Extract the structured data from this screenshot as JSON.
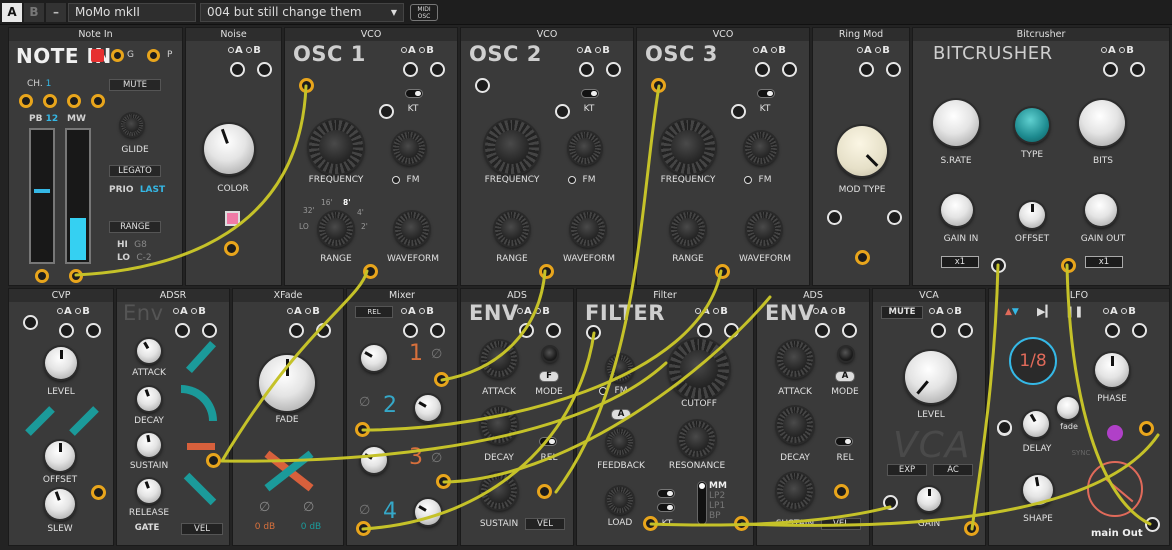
{
  "topbar": {
    "a": "A",
    "b": "B",
    "minus": "–",
    "preset_name": "MoMo mkII",
    "preset_slot": "004  but still change them",
    "arrow": "▼",
    "midi1": "MIDI",
    "midi2": "OSC"
  },
  "ab": {
    "a": "A",
    "b": "B"
  },
  "note_in": {
    "title": "Note In",
    "big": "NOTE IN",
    "g": "G",
    "p": "P",
    "ch_label": "CH.",
    "ch_value": "1",
    "pb_label": "PB",
    "pb_value": "12",
    "mw_label": "MW",
    "mute": "MUTE",
    "glide": "GLIDE",
    "legato": "LEGATO",
    "prio_label": "PRIO",
    "prio_value": "LAST",
    "range": "RANGE",
    "hi_label": "HI",
    "hi_value": "G8",
    "lo_label": "LO",
    "lo_value": "C-2",
    "pb_level": 0.55,
    "mw_level": 0.32
  },
  "noise": {
    "title": "Noise",
    "color": "COLOR"
  },
  "osc1": {
    "title": "VCO",
    "big": "OSC 1",
    "kt": "KT",
    "frequency": "FREQUENCY",
    "fm": "FM",
    "range": "RANGE",
    "waveform": "WAVEFORM",
    "r32": "32'",
    "r16": "16'",
    "r8": "8'",
    "r4": "4'",
    "r2": "2'",
    "rlo": "LO"
  },
  "osc2": {
    "title": "VCO",
    "big": "OSC 2",
    "kt": "KT",
    "frequency": "FREQUENCY",
    "fm": "FM",
    "range": "RANGE",
    "waveform": "WAVEFORM"
  },
  "osc3": {
    "title": "VCO",
    "big": "OSC 3",
    "kt": "KT",
    "frequency": "FREQUENCY",
    "fm": "FM",
    "range": "RANGE",
    "waveform": "WAVEFORM"
  },
  "ringmod": {
    "title": "Ring Mod",
    "modtype": "MOD TYPE"
  },
  "bitcrusher": {
    "title": "Bitcrusher",
    "big": "BITCRUSHER",
    "srate": "S.RATE",
    "type": "TYPE",
    "bits": "BITS",
    "gainin": "GAIN IN",
    "offset": "OFFSET",
    "gainout": "GAIN OUT",
    "x1a": "x1",
    "x1b": "x1"
  },
  "cvp": {
    "title": "CVP",
    "level": "LEVEL",
    "offset": "OFFSET",
    "slew": "SLEW"
  },
  "adsr": {
    "title": "ADSR",
    "big": "Env",
    "attack": "ATTACK",
    "decay": "DECAY",
    "sustain": "SUSTAIN",
    "release": "RELEASE",
    "gate": "GATE",
    "vel": "VEL"
  },
  "xfade": {
    "title": "XFade",
    "fade": "FADE",
    "db1": "0 dB",
    "db2": "0 dB"
  },
  "mixer": {
    "title": "Mixer",
    "rel": "REL",
    "n1": "1",
    "n2": "2",
    "n3": "3",
    "n4": "4"
  },
  "ads1": {
    "title": "ADS",
    "big": "ENV",
    "attack": "ATTACK",
    "mode": "MODE",
    "decay": "DECAY",
    "rel": "REL",
    "sustain": "SUSTAIN",
    "vel": "VEL",
    "f": "F"
  },
  "filter": {
    "title": "Filter",
    "big": "FILTER",
    "fm": "FM",
    "cutoff": "CUTOFF",
    "feedback": "FEEDBACK",
    "resonance": "RESONANCE",
    "load": "LOAD",
    "kt": "KT",
    "a": "A",
    "modes": [
      "MM",
      "LP2",
      "LP1",
      "BP"
    ]
  },
  "ads2": {
    "title": "ADS",
    "big": "ENV",
    "attack": "ATTACK",
    "mode": "MODE",
    "decay": "DECAY",
    "rel": "REL",
    "sustain": "SUSTAIN",
    "vel": "VEL",
    "a": "A"
  },
  "vca": {
    "title": "VCA",
    "mute": "MUTE",
    "level": "LEVEL",
    "big": "VCA",
    "exp": "EXP",
    "ac": "AC",
    "gain": "GAIN"
  },
  "lfo": {
    "title": "LFO",
    "rate": "1/8",
    "phase": "PHASE",
    "delay": "DELAY",
    "fade": "fade",
    "sync": "SYNC",
    "shape": "SHAPE",
    "main_out": "main Out"
  },
  "colors": {
    "cable": "#c5c229",
    "jack_orange": "#e8a51c",
    "accent_cyan": "#35b8e6",
    "accent_orange": "#d7703c",
    "teal": "#1b9a9a",
    "lfo_red": "#e06a5a"
  }
}
